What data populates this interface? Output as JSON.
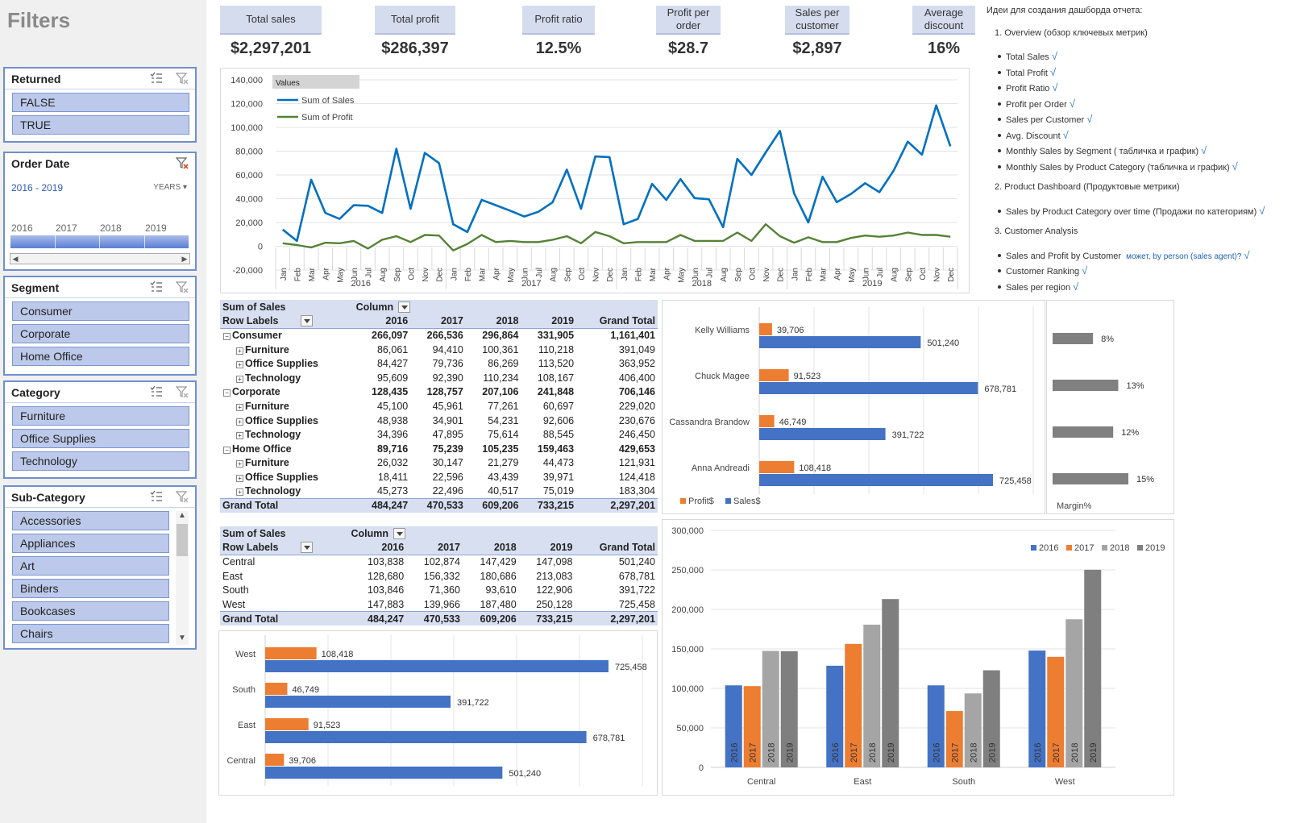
{
  "filters": {
    "title": "Filters",
    "returned": {
      "title": "Returned",
      "items": [
        "FALSE",
        "TRUE"
      ]
    },
    "order_date": {
      "title": "Order Date",
      "range": "2016 - 2019",
      "unit": "YEARS",
      "years": [
        "2016",
        "2017",
        "2018",
        "2019"
      ]
    },
    "segment": {
      "title": "Segment",
      "items": [
        "Consumer",
        "Corporate",
        "Home Office"
      ]
    },
    "category": {
      "title": "Category",
      "items": [
        "Furniture",
        "Office Supplies",
        "Technology"
      ]
    },
    "sub_category": {
      "title": "Sub-Category",
      "items": [
        "Accessories",
        "Appliances",
        "Art",
        "Binders",
        "Bookcases",
        "Chairs"
      ]
    }
  },
  "kpis": [
    {
      "label": "Total sales",
      "value": "$2,297,201"
    },
    {
      "label": "Total profit",
      "value": "$286,397"
    },
    {
      "label": "Profit ratio",
      "value": "12.5%"
    },
    {
      "label": "Profit per order",
      "value": "$28.7"
    },
    {
      "label": "Sales per customer",
      "value": "$2,897"
    },
    {
      "label": "Average discount",
      "value": "16%"
    }
  ],
  "notes": {
    "title": "Идеи для создания дашборда отчета:",
    "sections": [
      {
        "heading": "1. Overview (обзор ключевых метрик)",
        "items": [
          "Total Sales",
          "Total Profit",
          "Profit Ratio",
          "Profit per Order",
          "Sales per Customer",
          "Avg. Discount",
          "Monthly Sales by Segment ( табличка и график)",
          "Monthly Sales by Product Category (табличка и график)"
        ]
      },
      {
        "heading": "2. Product Dashboard (Продуктовые метрики)",
        "items": [
          "Sales by Product Category over time (Продажи по категориям)"
        ]
      },
      {
        "heading": "3. Customer Analysis",
        "items": [
          "Sales and Profit by Customer",
          "Customer Ranking",
          "Sales per region"
        ]
      }
    ],
    "extra": "может, by person (sales agent)?",
    "check": "√"
  },
  "pivot1": {
    "title": "Sum of Sales",
    "column_label": "Column",
    "row_label": "Row Labels",
    "years": [
      "2016",
      "2017",
      "2018",
      "2019"
    ],
    "grand_total_label": "Grand Total",
    "rows": [
      {
        "label": "Consumer",
        "kind": "seg",
        "values": [
          "266,097",
          "266,536",
          "296,864",
          "331,905",
          "1,161,401"
        ]
      },
      {
        "label": "Furniture",
        "kind": "cat",
        "values": [
          "86,061",
          "94,410",
          "100,361",
          "110,218",
          "391,049"
        ]
      },
      {
        "label": "Office Supplies",
        "kind": "cat",
        "values": [
          "84,427",
          "79,736",
          "86,269",
          "113,520",
          "363,952"
        ]
      },
      {
        "label": "Technology",
        "kind": "cat",
        "values": [
          "95,609",
          "92,390",
          "110,234",
          "108,167",
          "406,400"
        ]
      },
      {
        "label": "Corporate",
        "kind": "seg",
        "values": [
          "128,435",
          "128,757",
          "207,106",
          "241,848",
          "706,146"
        ]
      },
      {
        "label": "Furniture",
        "kind": "cat",
        "values": [
          "45,100",
          "45,961",
          "77,261",
          "60,697",
          "229,020"
        ]
      },
      {
        "label": "Office Supplies",
        "kind": "cat",
        "values": [
          "48,938",
          "34,901",
          "54,231",
          "92,606",
          "230,676"
        ]
      },
      {
        "label": "Technology",
        "kind": "cat",
        "values": [
          "34,396",
          "47,895",
          "75,614",
          "88,545",
          "246,450"
        ]
      },
      {
        "label": "Home Office",
        "kind": "seg",
        "values": [
          "89,716",
          "75,239",
          "105,235",
          "159,463",
          "429,653"
        ]
      },
      {
        "label": "Furniture",
        "kind": "cat",
        "values": [
          "26,032",
          "30,147",
          "21,279",
          "44,473",
          "121,931"
        ]
      },
      {
        "label": "Office Supplies",
        "kind": "cat",
        "values": [
          "18,411",
          "22,596",
          "43,439",
          "39,971",
          "124,418"
        ]
      },
      {
        "label": "Technology",
        "kind": "cat",
        "values": [
          "45,273",
          "22,496",
          "40,517",
          "75,019",
          "183,304"
        ]
      }
    ],
    "grand": [
      "484,247",
      "470,533",
      "609,206",
      "733,215",
      "2,297,201"
    ]
  },
  "pivot2": {
    "title": "Sum of Sales",
    "column_label": "Column",
    "row_label": "Row Labels",
    "years": [
      "2016",
      "2017",
      "2018",
      "2019"
    ],
    "grand_total_label": "Grand Total",
    "rows": [
      {
        "label": "Central",
        "values": [
          "103,838",
          "102,874",
          "147,429",
          "147,098",
          "501,240"
        ]
      },
      {
        "label": "East",
        "values": [
          "128,680",
          "156,332",
          "180,686",
          "213,083",
          "678,781"
        ]
      },
      {
        "label": "South",
        "values": [
          "103,846",
          "71,360",
          "93,610",
          "122,906",
          "391,722"
        ]
      },
      {
        "label": "West",
        "values": [
          "147,883",
          "139,966",
          "187,480",
          "250,128",
          "725,458"
        ]
      }
    ],
    "grand": [
      "484,247",
      "470,533",
      "609,206",
      "733,215",
      "2,297,201"
    ]
  },
  "colors": {
    "sales": "#0070c0",
    "profit": "#548235",
    "bar_blue": "#4472c4",
    "bar_orange": "#ed7d31",
    "bar_gray": "#a5a5a5",
    "bar_dark": "#7f7f7f",
    "margin": "#808080"
  },
  "chart_data": [
    {
      "type": "line",
      "legend_title": "Values",
      "months": [
        "Jan",
        "Feb",
        "Mar",
        "Apr",
        "May",
        "Jun",
        "Jul",
        "Aug",
        "Sep",
        "Oct",
        "Nov",
        "Dec"
      ],
      "year_labels": [
        "2016",
        "2017",
        "2018",
        "2019"
      ],
      "series": [
        {
          "name": "Sum of Sales",
          "values": [
            14000,
            4500,
            56000,
            28000,
            23000,
            34500,
            34000,
            28000,
            82000,
            31500,
            78500,
            70000,
            18500,
            12000,
            39000,
            34500,
            30000,
            25000,
            29000,
            37000,
            64500,
            31500,
            75500,
            75000,
            18500,
            23000,
            52500,
            39000,
            56500,
            40500,
            39500,
            16000,
            73500,
            60000,
            79000,
            97000,
            44500,
            20000,
            58500,
            37000,
            44000,
            53000,
            45500,
            63500,
            88000,
            77000,
            118500,
            84000
          ]
        },
        {
          "name": "Sum of Profit",
          "values": [
            2500,
            1000,
            -1000,
            3000,
            2500,
            4500,
            -2000,
            5500,
            8500,
            3500,
            9500,
            9000,
            -3500,
            2000,
            9500,
            3500,
            4500,
            3500,
            3500,
            5500,
            8500,
            2500,
            12000,
            8500,
            2500,
            3500,
            3500,
            3500,
            9500,
            4500,
            4500,
            4500,
            11500,
            4500,
            18500,
            8500,
            3000,
            7500,
            3500,
            3500,
            7000,
            9000,
            8000,
            9000,
            11500,
            9500,
            9500,
            8000
          ]
        }
      ],
      "ylim": [
        -20000,
        140000
      ],
      "yticks": [
        "140,000",
        "120,000",
        "100,000",
        "80,000",
        "60,000",
        "40,000",
        "20,000",
        "0",
        "-20,000"
      ]
    },
    {
      "type": "bar",
      "orientation": "horizontal",
      "categories": [
        "Kelly Williams",
        "Chuck Magee",
        "Cassandra Brandow",
        "Anna Andreadi"
      ],
      "series": [
        {
          "name": "Profit$",
          "values": [
            39706,
            91523,
            46749,
            108418
          ],
          "labels": [
            "39,706",
            "91,523",
            "46,749",
            "108,418"
          ]
        },
        {
          "name": "Sales$",
          "values": [
            501240,
            678781,
            391722,
            725458
          ],
          "labels": [
            "501,240",
            "678,781",
            "391,722",
            "725,458"
          ]
        }
      ]
    },
    {
      "type": "bar",
      "orientation": "horizontal",
      "series": [
        {
          "name": "Margin%",
          "values": [
            8,
            13,
            12,
            15
          ],
          "labels": [
            "8%",
            "13%",
            "12%",
            "15%"
          ]
        }
      ]
    },
    {
      "type": "bar",
      "orientation": "horizontal",
      "categories": [
        "West",
        "South",
        "East",
        "Central"
      ],
      "series": [
        {
          "name": "Profit$",
          "values": [
            108418,
            46749,
            91523,
            39706
          ],
          "labels": [
            "108,418",
            "46,749",
            "91,523",
            "39,706"
          ]
        },
        {
          "name": "Sales$",
          "values": [
            725458,
            391722,
            678781,
            501240
          ],
          "labels": [
            "725,458",
            "391,722",
            "678,781",
            "501,240"
          ]
        }
      ]
    },
    {
      "type": "bar",
      "categories": [
        "Central",
        "East",
        "South",
        "West"
      ],
      "series": [
        {
          "name": "2016",
          "values": [
            103838,
            128680,
            103846,
            147883
          ]
        },
        {
          "name": "2017",
          "values": [
            102874,
            156332,
            71360,
            139966
          ]
        },
        {
          "name": "2018",
          "values": [
            147429,
            180686,
            93610,
            187480
          ]
        },
        {
          "name": "2019",
          "values": [
            147098,
            213083,
            122906,
            250128
          ]
        }
      ],
      "ylim": [
        0,
        300000
      ],
      "yticks": [
        "300,000",
        "250,000",
        "200,000",
        "150,000",
        "100,000",
        "50,000",
        "0"
      ]
    }
  ]
}
